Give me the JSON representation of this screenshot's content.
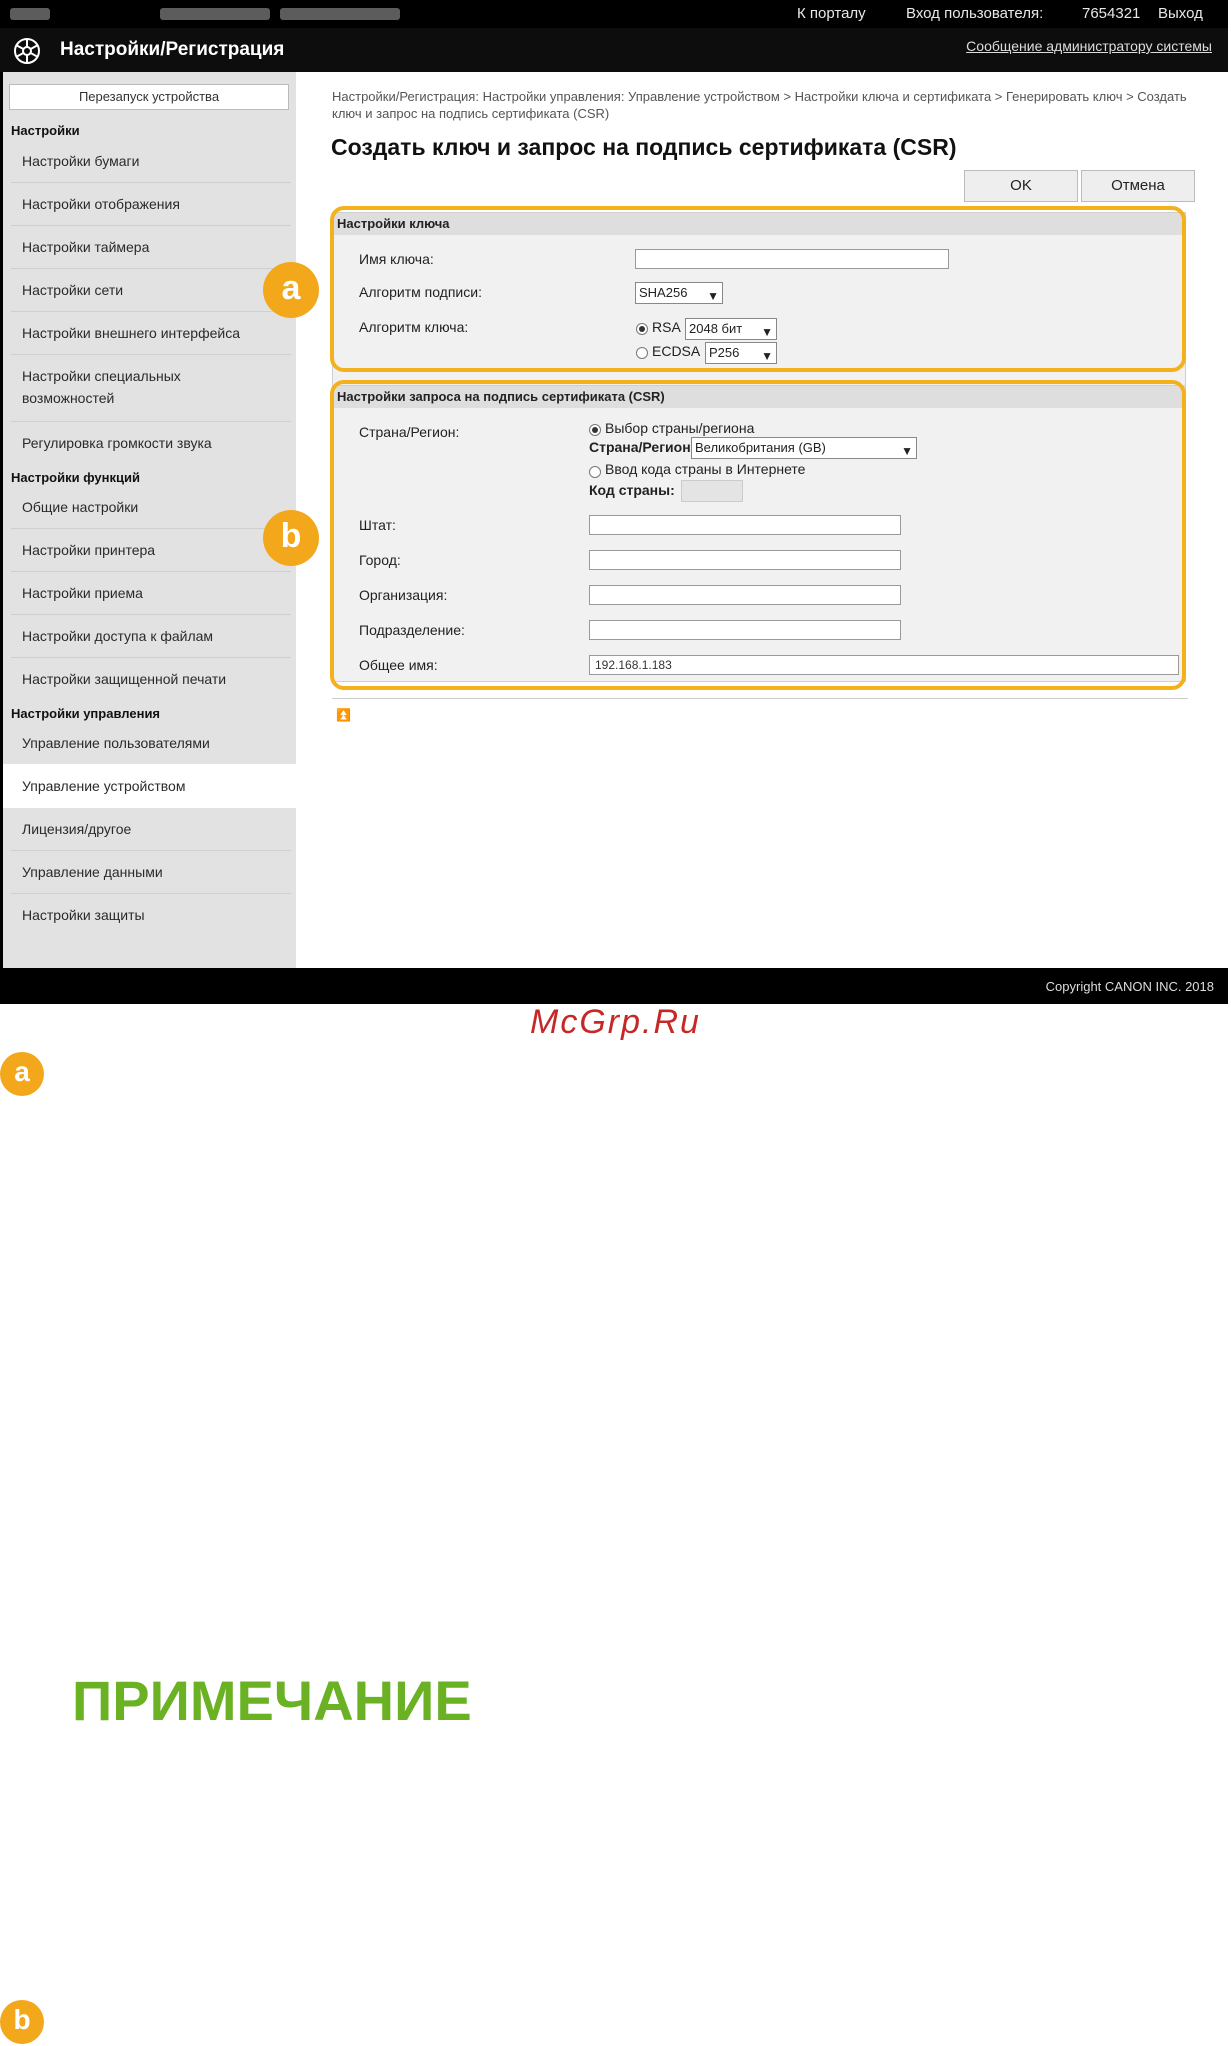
{
  "topbar": {
    "portal": "К порталу",
    "login": "Вход пользователя:",
    "user_id": "7654321",
    "logout": "Выход"
  },
  "header": {
    "title": "Настройки/Регистрация",
    "admin_message": "Сообщение администратору системы"
  },
  "sidebar": {
    "restart": "Перезапуск устройства",
    "section1": "Настройки",
    "items1": [
      "Настройки бумаги",
      "Настройки отображения",
      "Настройки таймера",
      "Настройки сети",
      "Настройки внешнего интерфейса",
      "Настройки специальных возможностей",
      "Регулировка громкости звука"
    ],
    "section2": "Настройки функций",
    "items2": [
      "Общие настройки",
      "Настройки принтера",
      "Настройки приема",
      "Настройки доступа к файлам",
      "Настройки защищенной печати"
    ],
    "section3": "Настройки управления",
    "items3": [
      "Управление пользователями",
      "Управление устройством",
      "Лицензия/другое",
      "Управление данными",
      "Настройки защиты"
    ]
  },
  "main": {
    "breadcrumb": "Настройки/Регистрация: Настройки управления: Управление устройством > Настройки ключа и сертификата > Генерировать ключ > Создать ключ и запрос на подпись сертификата (CSR)",
    "title": "Создать ключ и запрос на подпись сертификата (CSR)",
    "ok": "OK",
    "cancel": "Отмена",
    "key": {
      "heading": "Настройки ключа",
      "name_label": "Имя ключа:",
      "name_value": "",
      "sig_label": "Алгоритм подписи:",
      "sig_value": "SHA256",
      "alg_label": "Алгоритм ключа:",
      "rsa": "RSA",
      "rsa_size": "2048 бит",
      "ecdsa": "ECDSA",
      "ecdsa_curve": "P256"
    },
    "csr": {
      "heading": "Настройки запроса на подпись сертификата (CSR)",
      "country_label": "Страна/Регион:",
      "choose": "Выбор страны/региона",
      "country_sub": "Страна/Регион:",
      "country_value": "Великобритания (GB)",
      "enter_code": "Ввод кода страны в Интернете",
      "code_label": "Код страны:",
      "state": "Штат:",
      "city": "Город:",
      "org": "Организация:",
      "unit": "Подразделение:",
      "common": "Общее имя:",
      "common_value": "192.168.1.183"
    }
  },
  "footer": {
    "copyright": "Copyright CANON INC. 2018"
  },
  "markers": {
    "a": "a",
    "b": "b"
  },
  "watermark": "McGrp.Ru",
  "note": "ПРИМЕЧАНИЕ",
  "colors": {
    "highlight": "#f3b11e",
    "marker": "#f3a81c",
    "note": "#6ab123",
    "watermark": "#c62828"
  }
}
